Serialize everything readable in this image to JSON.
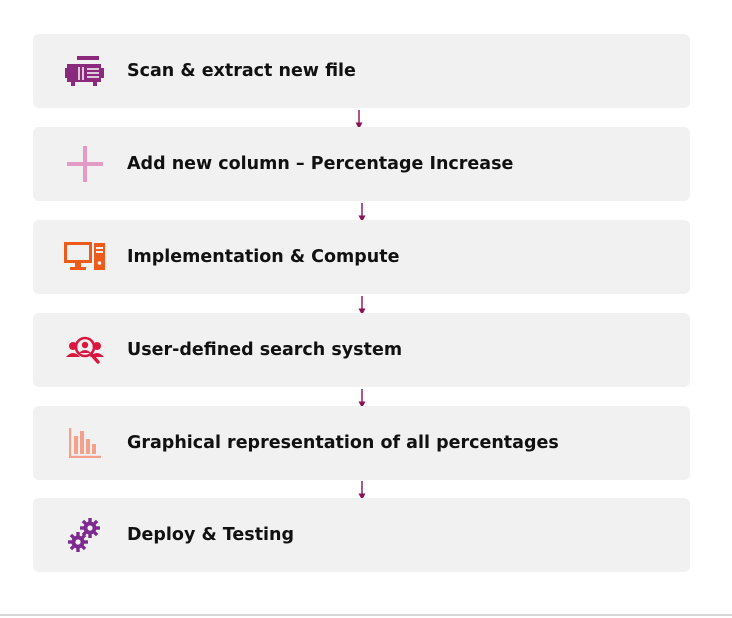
{
  "steps": [
    {
      "label": "Scan & extract new file",
      "icon": "scanner-icon",
      "color": "#8b2a7c"
    },
    {
      "label": "Add new column – Percentage Increase",
      "icon": "plus-icon",
      "color": "#e39ac5"
    },
    {
      "label": "Implementation & Compute",
      "icon": "computer-icon",
      "color": "#ec5a1c"
    },
    {
      "label": "User-defined search system",
      "icon": "user-search-icon",
      "color": "#d9173f"
    },
    {
      "label": "Graphical representation of all percentages",
      "icon": "bar-chart-icon",
      "color": "#f5a08a"
    },
    {
      "label": "Deploy & Testing",
      "icon": "gears-icon",
      "color": "#7f2a90"
    }
  ],
  "arrow_color": "#8a1157"
}
